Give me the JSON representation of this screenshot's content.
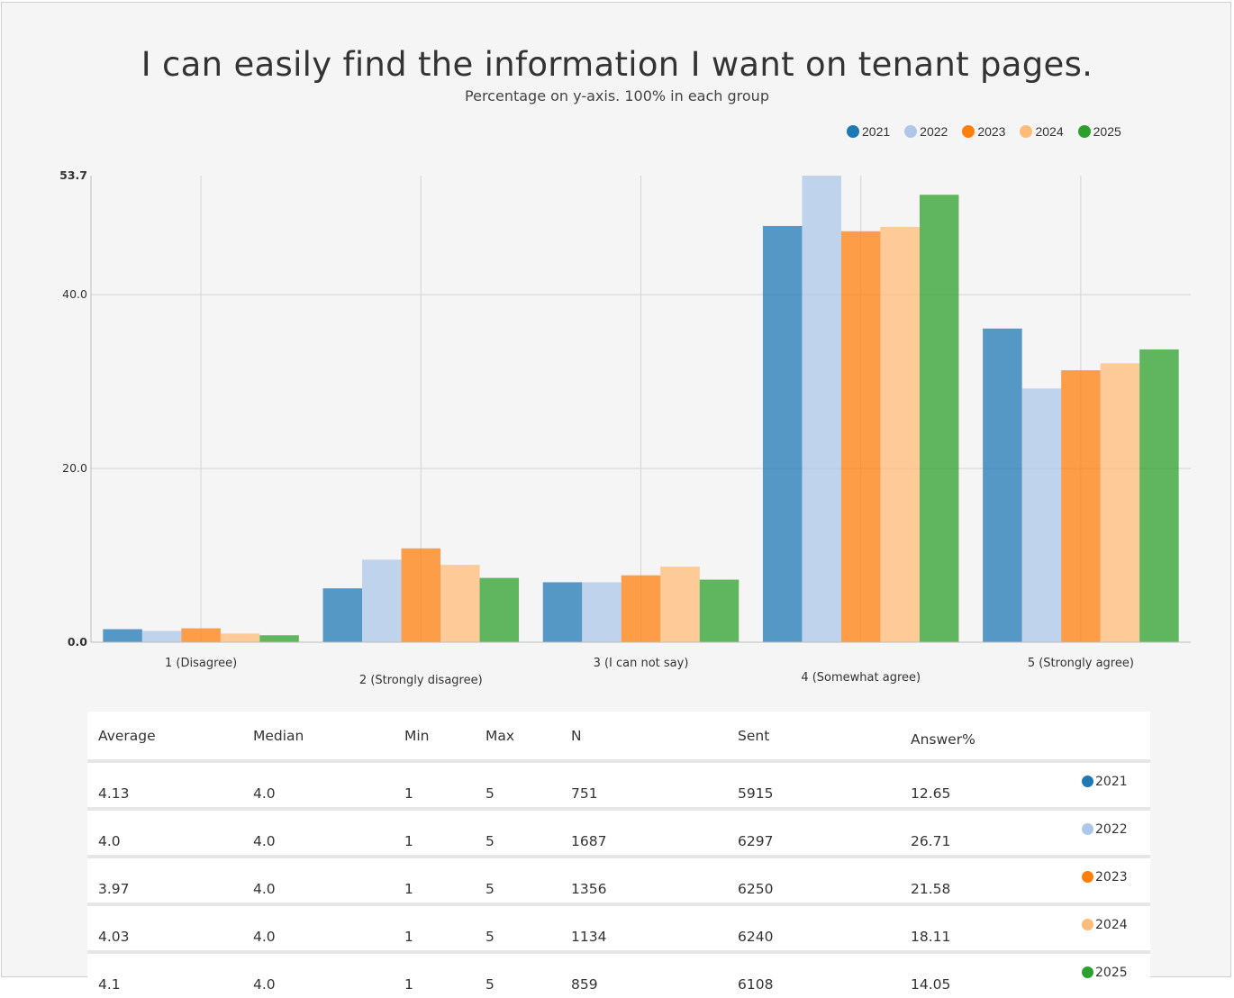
{
  "chart_data": {
    "type": "bar",
    "title": "I can easily find the information I want on tenant pages.",
    "subtitle": "Percentage on y-axis. 100% in each group",
    "categories": [
      "1 (Disagree)",
      "2 (Strongly disagree)",
      "3 (I can not say)",
      "4 (Somewhat agree)",
      "5 (Strongly agree)"
    ],
    "series": [
      {
        "name": "2021",
        "color": "#1f77b4",
        "values": [
          1.5,
          6.2,
          6.9,
          47.9,
          36.1
        ]
      },
      {
        "name": "2022",
        "color": "#aec7e8",
        "values": [
          1.3,
          9.5,
          6.9,
          53.7,
          29.2
        ]
      },
      {
        "name": "2023",
        "color": "#ff7f0e",
        "values": [
          1.6,
          10.8,
          7.7,
          47.3,
          31.3
        ]
      },
      {
        "name": "2024",
        "color": "#ffbb78",
        "values": [
          1.0,
          8.9,
          8.7,
          47.8,
          32.1
        ]
      },
      {
        "name": "2025",
        "color": "#2ca02c",
        "values": [
          0.8,
          7.4,
          7.2,
          51.5,
          33.7
        ]
      }
    ],
    "yticks": [
      "0.0",
      "20.0",
      "40.0",
      "53.7"
    ],
    "ylim": [
      0,
      53.7
    ],
    "grid": true,
    "legend_position": "top-right"
  },
  "stats_table": {
    "headers": [
      "Average",
      "Median",
      "Min",
      "Max",
      "N",
      "Sent",
      "Answer%"
    ],
    "rows": [
      {
        "average": "4.13",
        "median": "4.0",
        "min": "1",
        "max": "5",
        "n": "751",
        "sent": "5915",
        "answer": "12.65",
        "year": "2021",
        "color": "#1f77b4"
      },
      {
        "average": "4.0",
        "median": "4.0",
        "min": "1",
        "max": "5",
        "n": "1687",
        "sent": "6297",
        "answer": "26.71",
        "year": "2022",
        "color": "#aec7e8"
      },
      {
        "average": "3.97",
        "median": "4.0",
        "min": "1",
        "max": "5",
        "n": "1356",
        "sent": "6250",
        "answer": "21.58",
        "year": "2023",
        "color": "#ff7f0e"
      },
      {
        "average": "4.03",
        "median": "4.0",
        "min": "1",
        "max": "5",
        "n": "1134",
        "sent": "6240",
        "answer": "18.11",
        "year": "2024",
        "color": "#ffbb78"
      },
      {
        "average": "4.1",
        "median": "4.0",
        "min": "1",
        "max": "5",
        "n": "859",
        "sent": "6108",
        "answer": "14.05",
        "year": "2025",
        "color": "#2ca02c"
      }
    ]
  }
}
